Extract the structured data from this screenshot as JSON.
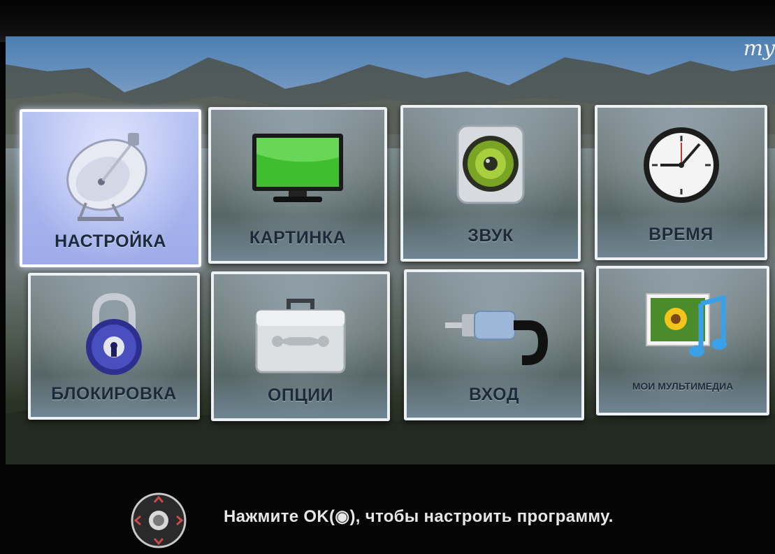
{
  "brand": "my",
  "menu": {
    "items": [
      {
        "label": "НАСТРОЙКА",
        "icon": "satellite-dish-icon",
        "selected": true
      },
      {
        "label": "КАРТИНКА",
        "icon": "tv-screen-icon",
        "selected": false
      },
      {
        "label": "ЗВУК",
        "icon": "speaker-icon",
        "selected": false
      },
      {
        "label": "ВРЕМЯ",
        "icon": "clock-icon",
        "selected": false
      },
      {
        "label": "БЛОКИРОВКА",
        "icon": "padlock-icon",
        "selected": false
      },
      {
        "label": "ОПЦИИ",
        "icon": "toolbox-icon",
        "selected": false
      },
      {
        "label": "ВХОД",
        "icon": "cable-plug-icon",
        "selected": false
      },
      {
        "label": "МОИ МУЛЬТИМЕДИА",
        "icon": "multimedia-icon",
        "selected": false
      }
    ]
  },
  "hint": {
    "nav_icon": "navigation-pad-icon",
    "text": "Нажмите OK(◉), чтобы настроить программу."
  },
  "colors": {
    "selected_tile": "#b5bff2",
    "tile_border": "#eef1f4",
    "label_text": "#1d2a3a",
    "hint_text": "#e6e6e6"
  }
}
